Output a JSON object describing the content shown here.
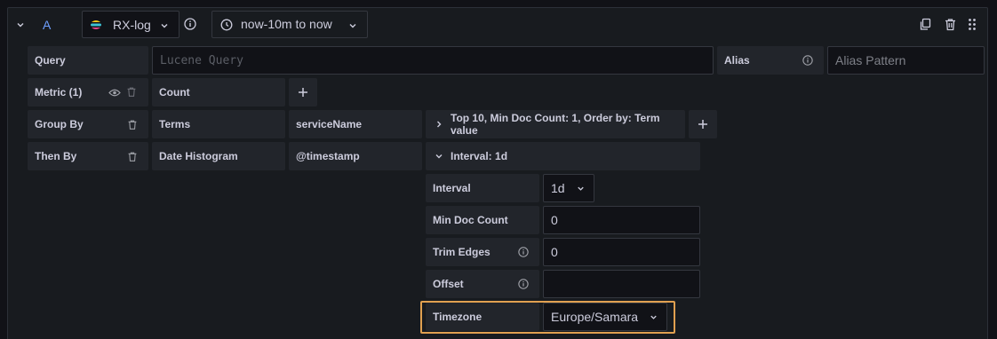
{
  "header": {
    "refid": "A",
    "datasource": "RX-log",
    "time_range": "now-10m to now"
  },
  "query_row": {
    "query_label": "Query",
    "query_placeholder": "Lucene Query",
    "alias_label": "Alias",
    "alias_placeholder": "Alias Pattern"
  },
  "metric_row": {
    "label": "Metric (1)",
    "type": "Count"
  },
  "group_by_row": {
    "label": "Group By",
    "type": "Terms",
    "field": "serviceName",
    "settings": "Top 10, Min Doc Count: 1, Order by: Term value"
  },
  "then_by_row": {
    "label": "Then By",
    "type": "Date Histogram",
    "field": "@timestamp",
    "settings": "Interval: 1d"
  },
  "interval_settings": {
    "interval_label": "Interval",
    "interval_value": "1d",
    "min_doc_count_label": "Min Doc Count",
    "min_doc_count_value": "0",
    "trim_edges_label": "Trim Edges",
    "trim_edges_value": "0",
    "offset_label": "Offset",
    "offset_value": "",
    "timezone_label": "Timezone",
    "timezone_value": "Europe/Samara"
  },
  "colors": {
    "accent": "#6e9fff",
    "highlight_border": "#e0a050",
    "panel_bg": "#181b1f"
  }
}
